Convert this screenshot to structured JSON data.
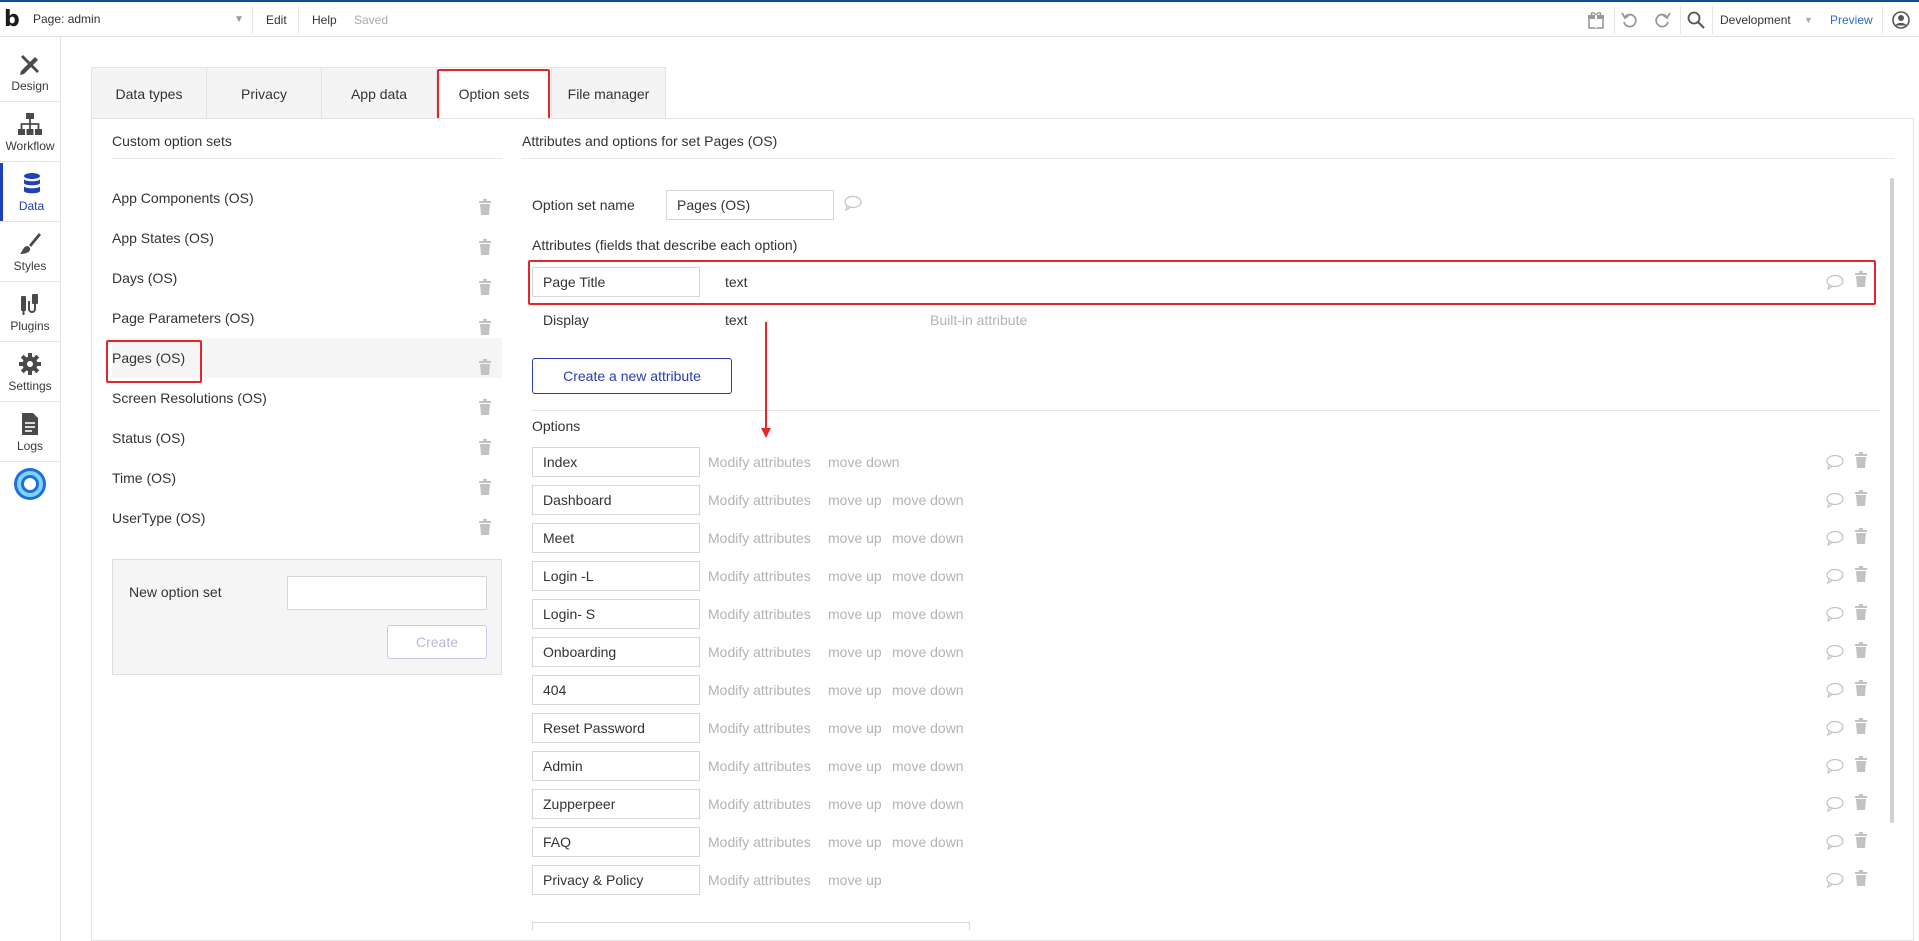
{
  "topbar": {
    "logo": "b",
    "page_select": "Page: admin",
    "menu_edit": "Edit",
    "menu_help": "Help",
    "status": "Saved",
    "environment": "Development",
    "preview": "Preview",
    "icons": [
      "gift-icon",
      "undo-icon",
      "redo-icon",
      "search-icon",
      "account-icon"
    ]
  },
  "sidebar": {
    "items": [
      {
        "label": "Design",
        "icon": "design-icon"
      },
      {
        "label": "Workflow",
        "icon": "workflow-icon"
      },
      {
        "label": "Data",
        "icon": "database-icon",
        "active": true
      },
      {
        "label": "Styles",
        "icon": "brush-icon"
      },
      {
        "label": "Plugins",
        "icon": "plug-icon"
      },
      {
        "label": "Settings",
        "icon": "gear-icon"
      },
      {
        "label": "Logs",
        "icon": "document-icon"
      }
    ],
    "extra_icon": "ring-logo-icon"
  },
  "tabs": [
    {
      "label": "Data types"
    },
    {
      "label": "Privacy"
    },
    {
      "label": "App data"
    },
    {
      "label": "Option sets",
      "active": true
    },
    {
      "label": "File manager"
    }
  ],
  "left": {
    "title": "Custom option sets",
    "option_sets": [
      "App Components (OS)",
      "App States (OS)",
      "Days (OS)",
      "Page Parameters (OS)",
      "Pages (OS)",
      "Screen Resolutions (OS)",
      "Status (OS)",
      "Time (OS)",
      "UserType (OS)"
    ],
    "selected_index": 4,
    "new_label": "New option set",
    "new_input_value": "",
    "create_button": "Create"
  },
  "right": {
    "title": "Attributes and options for set Pages (OS)",
    "name_label": "Option set name",
    "name_value": "Pages (OS)",
    "attributes_title": "Attributes (fields that describe each option)",
    "attributes": [
      {
        "name": "Page Title",
        "type": "text",
        "note": ""
      },
      {
        "name": "Display",
        "type": "text",
        "note": "Built-in attribute"
      }
    ],
    "create_attribute_button": "Create a new attribute",
    "options_title": "Options",
    "action_modify": "Modify attributes",
    "action_up": "move up",
    "action_down": "move down",
    "options": [
      {
        "name": "Index",
        "up": false,
        "down": true
      },
      {
        "name": "Dashboard",
        "up": true,
        "down": true
      },
      {
        "name": "Meet",
        "up": true,
        "down": true
      },
      {
        "name": "Login -L",
        "up": true,
        "down": true
      },
      {
        "name": "Login- S",
        "up": true,
        "down": true
      },
      {
        "name": "Onboarding",
        "up": true,
        "down": true
      },
      {
        "name": "404",
        "up": true,
        "down": true
      },
      {
        "name": "Reset Password",
        "up": true,
        "down": true
      },
      {
        "name": "Admin",
        "up": true,
        "down": true
      },
      {
        "name": "Zupperpeer",
        "up": true,
        "down": true
      },
      {
        "name": "FAQ",
        "up": true,
        "down": true
      },
      {
        "name": "Privacy & Policy",
        "up": true,
        "down": false
      }
    ]
  },
  "colors": {
    "accent": "#1f3fbf",
    "highlight": "#e3262b",
    "muted": "#b3b3b3"
  }
}
